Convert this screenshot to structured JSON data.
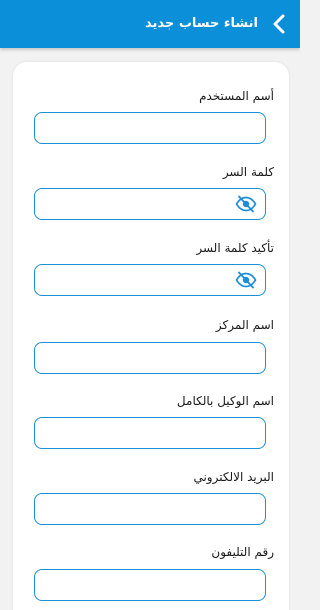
{
  "header": {
    "title": "انشاء حساب جديد",
    "back_icon": "chevron-left-icon"
  },
  "form": {
    "fields": [
      {
        "label": "أسم المستخدم",
        "value": "",
        "type": "text"
      },
      {
        "label": "كلمة السر",
        "value": "",
        "type": "password",
        "trailing_icon": "eye-slash-icon"
      },
      {
        "label": "تأكيد كلمة السر",
        "value": "",
        "type": "password",
        "trailing_icon": "eye-slash-icon"
      },
      {
        "label": "اسم المركز",
        "value": "",
        "type": "text"
      },
      {
        "label": "اسم الوكيل بالكامل",
        "value": "",
        "type": "text"
      },
      {
        "label": "البريد الالكتروني",
        "value": "",
        "type": "email"
      },
      {
        "label": "رقم التليفون",
        "value": "",
        "type": "tel"
      }
    ]
  },
  "colors": {
    "header_bg": "#0b8fd9",
    "input_border": "#1c8fd6",
    "page_bg": "#f2f2f2"
  }
}
